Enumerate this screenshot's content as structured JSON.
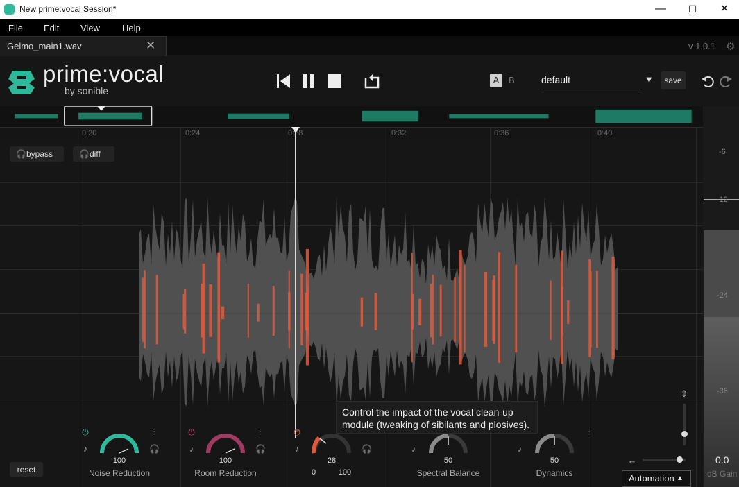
{
  "window": {
    "title": "New prime:vocal Session*",
    "minimize": "—",
    "maximize": "☐",
    "close": "✕"
  },
  "menu": [
    "File",
    "Edit",
    "View",
    "Help"
  ],
  "tab": {
    "label": "Gelmo_main1.wav",
    "close": "✕"
  },
  "version": "v 1.0.1",
  "brand": {
    "name": "prime:vocal",
    "by": "by sonible"
  },
  "transport": {
    "skip_back": "skip-back-icon",
    "pause": "pause-icon",
    "stop": "stop-icon",
    "loop": "loop-icon"
  },
  "ab": {
    "a": "A",
    "b": "B"
  },
  "preset": {
    "value": "default",
    "save_label": "save"
  },
  "timeline": [
    "0:20",
    "0:24",
    "0:28",
    "0:32",
    "0:36",
    "0:40"
  ],
  "monitor": {
    "bypass": "bypass",
    "diff": "diff"
  },
  "meter": {
    "labels": [
      "-6",
      "-12",
      "-24",
      "-36"
    ],
    "gain_value": "0.0",
    "gain_label": "dB Gain"
  },
  "tooltip": {
    "text": "Control the impact of the vocal clean-up module (tweaking of sibilants and plosives)."
  },
  "modules": [
    {
      "name": "Noise Reduction",
      "value": "100",
      "color": "#2fb99b",
      "level": 1.0
    },
    {
      "name": "Room Reduction",
      "value": "100",
      "color": "#c0406e",
      "level": 1.0
    },
    {
      "name": "",
      "value": "28",
      "min": "0",
      "max": "100",
      "color": "#e0593c",
      "level": 0.28
    },
    {
      "name": "Spectral Balance",
      "value": "50",
      "color": "#999999",
      "level": 0.5
    },
    {
      "name": "Dynamics",
      "value": "50",
      "color": "#999999",
      "level": 0.5
    }
  ],
  "reset_label": "reset",
  "automation_label": "Automation",
  "colors": {
    "accent": "#2fb99b",
    "waveform": "#505050",
    "highlight": "#e0593c"
  }
}
